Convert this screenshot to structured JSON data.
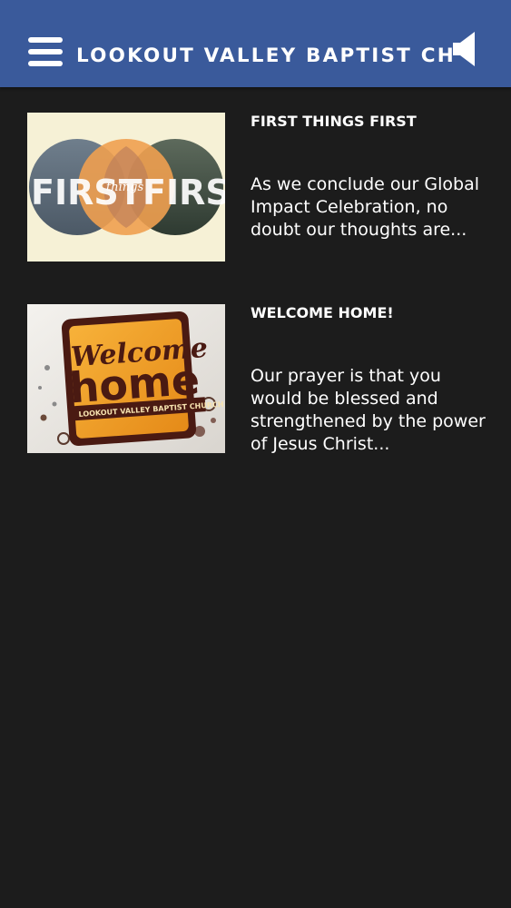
{
  "header": {
    "title": "LOOKOUT VALLEY BAPTIST CHURCH",
    "menu_icon": "hamburger-menu-icon",
    "speaker_icon": "speaker-icon",
    "background_color": "#3a5a9b"
  },
  "feed": {
    "items": [
      {
        "title": "FIRST THINGS FIRST",
        "description": "As we conclude our Global Impact Celebration, no doubt our thoughts are...",
        "image": {
          "word_left": "FIRST",
          "word_middle": "things",
          "word_right": "FIRST"
        }
      },
      {
        "title": "WELCOME HOME!",
        "description": "Our prayer is that you would be blessed and strengthened by the power of Jesus Christ...",
        "image": {
          "word_top": "Welcome",
          "word_main": "home",
          "caption": "LOOKOUT VALLEY BAPTIST CHURCH"
        }
      }
    ]
  }
}
